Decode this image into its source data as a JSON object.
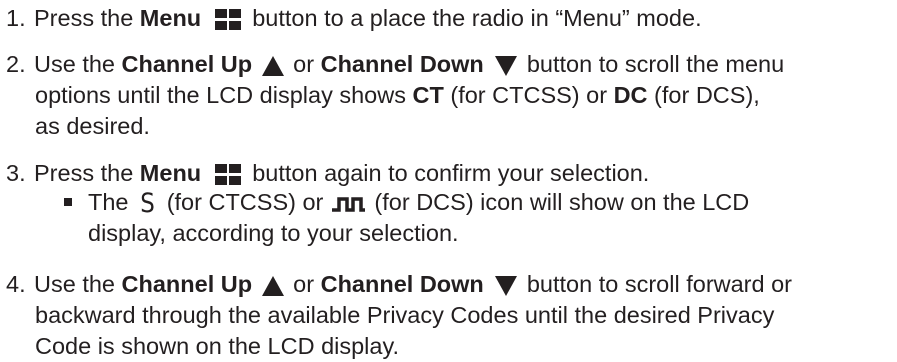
{
  "step1": {
    "num": "1.",
    "t1": "Press the ",
    "b1": "Menu",
    "icon": "menu-icon",
    "t2": " button to a place the radio in “Menu” mode."
  },
  "step2": {
    "num": "2.",
    "t1": "Use the ",
    "b1": "Channel Up",
    "icon1": "triangle-up-icon",
    "t2": " or ",
    "b2": "Channel Down",
    "icon2": "triangle-down-icon",
    "t3": " button to scroll the menu",
    "line2_t1": "options until the LCD display shows ",
    "line2_b1": "CT",
    "line2_t2": " (for CTCSS) or ",
    "line2_b2": "DC",
    "line2_t3": " (for DCS),",
    "line3": "as desired."
  },
  "step3": {
    "num": "3.",
    "t1": "Press the ",
    "b1": "Menu",
    "icon": "menu-icon",
    "t2": " button again to confirm your selection.",
    "sub": {
      "t1": "The ",
      "s_icon_char": "S",
      "t2": " (for CTCSS) or ",
      "dcs_icon": "dcs-wave-icon",
      "t3": " (for DCS) icon will show on the LCD",
      "line2": "display, according to your selection."
    }
  },
  "step4": {
    "num": "4.",
    "t1": "Use the ",
    "b1": "Channel Up",
    "icon1": "triangle-up-icon",
    "t2": " or ",
    "b2": "Channel Down",
    "icon2": "triangle-down-icon",
    "t3": " button to scroll forward or",
    "line2": "backward through the available Privacy Codes until the desired Privacy",
    "line3": "Code is shown on the LCD display."
  },
  "colors": {
    "text": "#231f20"
  }
}
